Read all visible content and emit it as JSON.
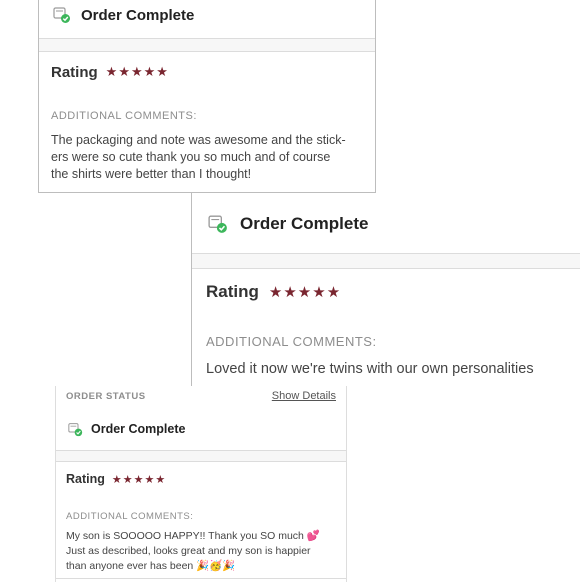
{
  "colors": {
    "accent_star": "#7a2630",
    "status_check": "#3cb65b"
  },
  "cards": [
    {
      "status_title": "Order Complete",
      "status_icon": "order-complete-icon",
      "rating_label": "Rating",
      "rating_stars": 5,
      "rating_max": 5,
      "comments_label": "ADDITIONAL COMMENTS:",
      "comment_lines": [
        "The packaging and note was awesome and the stick-",
        "ers were so cute thank you so much and of course",
        "the shirts were better than I thought!"
      ]
    },
    {
      "status_title": "Order Complete",
      "status_icon": "order-complete-icon",
      "rating_label": "Rating",
      "rating_stars": 5,
      "rating_max": 5,
      "comments_label": "ADDITIONAL COMMENTS:",
      "comment_lines": [
        "Loved it now we're twins with our own personalities"
      ]
    },
    {
      "order_status_label": "ORDER STATUS",
      "show_details_link": "Show Details",
      "status_title": "Order Complete",
      "status_icon": "order-complete-icon",
      "rating_label": "Rating",
      "rating_stars": 5,
      "rating_max": 5,
      "comments_label": "ADDITIONAL COMMENTS:",
      "comment_lines": [
        "My son is SOOOOO HAPPY!! Thank you SO much 💕",
        "Just as described, looks great and my son is happier",
        "than anyone ever has been 🎉🥳🎉"
      ]
    }
  ]
}
